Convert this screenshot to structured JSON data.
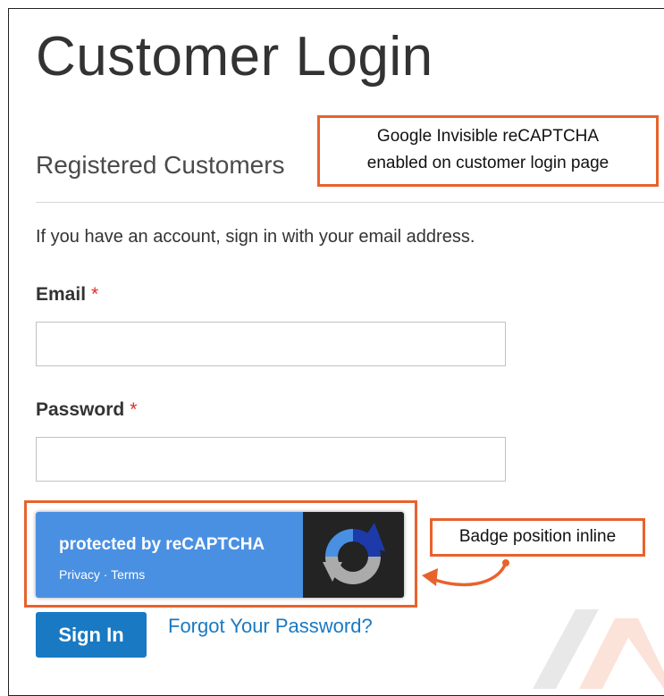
{
  "page": {
    "title": "Customer Login",
    "section_title": "Registered Customers",
    "intro": "If you have an account, sign in with your email address."
  },
  "form": {
    "email_label": "Email",
    "email_required": "*",
    "email_value": "",
    "password_label": "Password",
    "password_required": "*",
    "password_value": "",
    "sign_in_label": "Sign In",
    "forgot_label": "Forgot Your Password?"
  },
  "recaptcha": {
    "protected_text": "protected by reCAPTCHA",
    "privacy_label": "Privacy",
    "separator": " · ",
    "terms_label": "Terms",
    "icon": "recaptcha-logo-icon"
  },
  "annotations": {
    "top_line1": "Google Invisible reCAPTCHA",
    "top_line2": "enabled on customer login page",
    "badge_note": "Badge position inline"
  },
  "colors": {
    "accent": "#1979c3",
    "annotation": "#e8622c",
    "required": "#e02b27",
    "recaptcha_blue": "#4a90e2",
    "recaptcha_dark": "#232323"
  }
}
